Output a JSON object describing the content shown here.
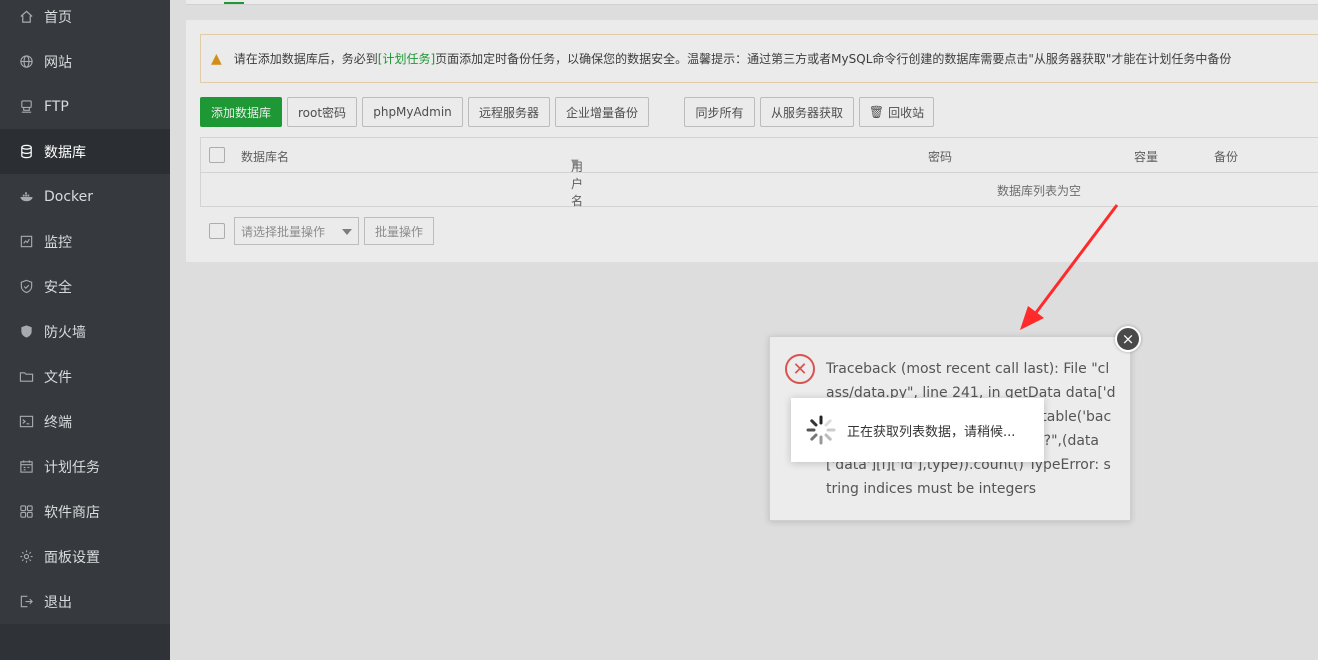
{
  "sidebar": {
    "items": [
      {
        "label": "首页",
        "icon": "home-icon"
      },
      {
        "label": "网站",
        "icon": "globe-icon"
      },
      {
        "label": "FTP",
        "icon": "ftp-icon"
      },
      {
        "label": "数据库",
        "icon": "database-icon",
        "active": true
      },
      {
        "label": "Docker",
        "icon": "docker-icon"
      },
      {
        "label": "监控",
        "icon": "monitor-icon"
      },
      {
        "label": "安全",
        "icon": "shield-icon"
      },
      {
        "label": "防火墙",
        "icon": "firewall-icon"
      },
      {
        "label": "文件",
        "icon": "folder-icon"
      },
      {
        "label": "终端",
        "icon": "terminal-icon"
      },
      {
        "label": "计划任务",
        "icon": "calendar-icon"
      },
      {
        "label": "软件商店",
        "icon": "apps-icon"
      },
      {
        "label": "面板设置",
        "icon": "gear-icon"
      },
      {
        "label": "退出",
        "icon": "logout-icon"
      }
    ]
  },
  "warning": {
    "before": "请在添加数据库后，务必到",
    "link": "[计划任务]",
    "after": "页面添加定时备份任务，以确保您的数据安全。温馨提示：通过第三方或者MySQL命令行创建的数据库需要点击\"从服务器获取\"才能在计划任务中备份"
  },
  "toolbar": {
    "add_db": "添加数据库",
    "root_pwd": "root密码",
    "phpmyadmin": "phpMyAdmin",
    "remote": "远程服务器",
    "enterprise_backup": "企业增量备份",
    "sync_all": "同步所有",
    "fetch_server": "从服务器获取",
    "recycle": "回收站"
  },
  "table": {
    "columns": {
      "name": "数据库名",
      "user": "用户名",
      "password": "密码",
      "capacity": "容量",
      "backup": "备份"
    },
    "empty": "数据库列表为空"
  },
  "batch": {
    "placeholder": "请选择批量操作",
    "button": "批量操作"
  },
  "error_dialog": {
    "message": "Traceback (most recent call last): File \"class/data.py\", line 241, in getData data['data'][i]['backup_count'] = SQL.table('backup').where(\"pid=? AND type=?\",(data['data'][i]['id'],type)).count() TypeError: string indices must be integers",
    "close": "×"
  },
  "loading": {
    "text": "正在获取列表数据，请稍候..."
  },
  "colors": {
    "accent": "#20a53a",
    "sidebar_bg": "#363a3f",
    "error": "#d9534f",
    "annotation_arrow": "#ff2a2a"
  }
}
